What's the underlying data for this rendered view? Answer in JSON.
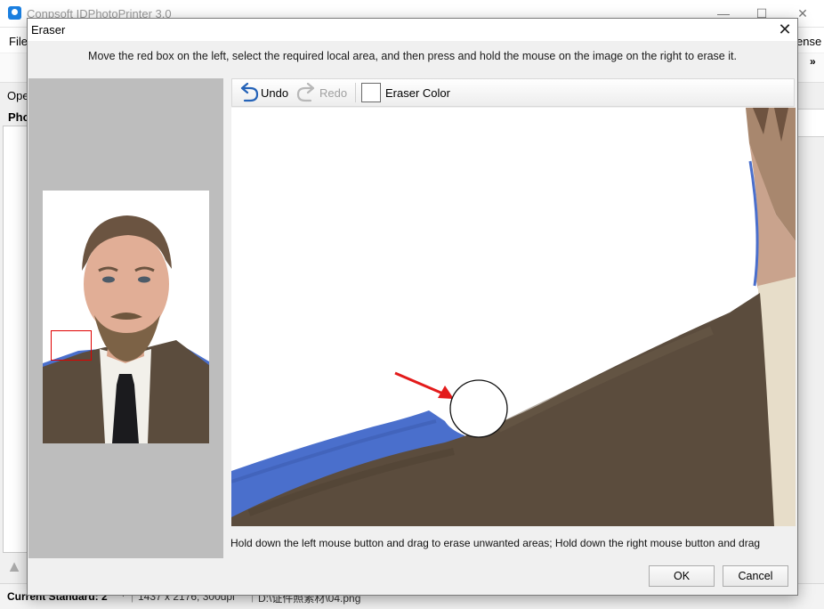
{
  "app": {
    "title": "Conpsoft IDPhotoPrinter 3.0",
    "menu_file": "File",
    "menu_license": "ense",
    "toolbar_more": "»",
    "open_label": "Ope",
    "photo_tab": "Phot",
    "status": {
      "standard": "Current Standard: 2",
      "dimensions": "1437 x 2176, 300dpi",
      "path": "D:\\证件照素材\\04.png"
    }
  },
  "dialog": {
    "title": "Eraser",
    "instruction": "Move the red box on the left, select the required local area, and then press and hold the mouse on the image on the right to erase it.",
    "toolbar": {
      "undo": "Undo",
      "redo": "Redo",
      "eraser_color": "Eraser Color"
    },
    "eraser_color_value": "#ffffff",
    "hint": "Hold down the left mouse button and drag to erase unwanted areas; Hold down the right mouse button and drag",
    "ok": "OK",
    "cancel": "Cancel"
  },
  "colors": {
    "jacket": "#5b4c3d",
    "background_blue": "#4a6fcc",
    "selection_box": "#e00000",
    "annotation_arrow": "#e31b1b"
  }
}
